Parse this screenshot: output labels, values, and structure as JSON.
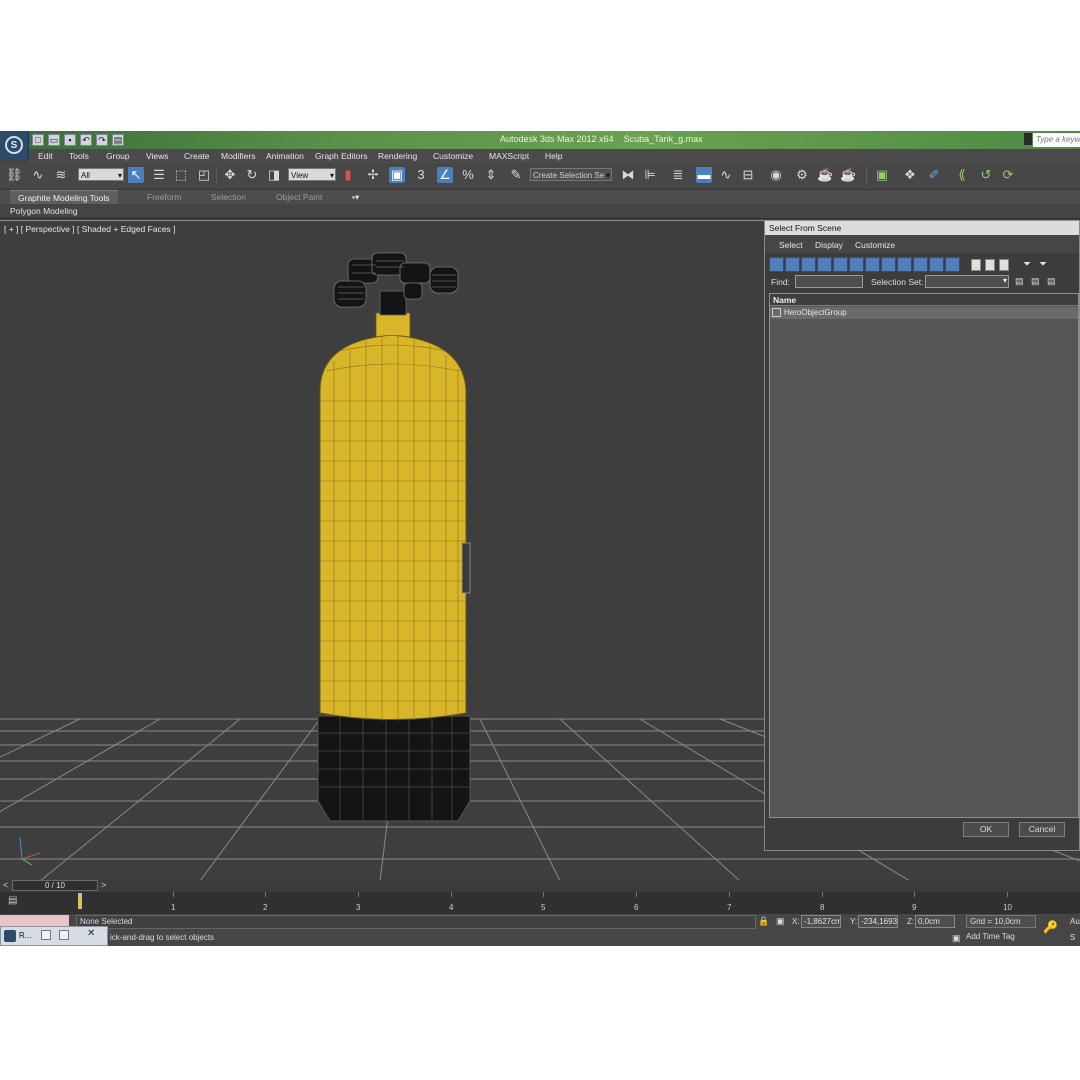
{
  "window": {
    "app_title": "Autodesk 3ds Max  2012 x64",
    "file_name": "Scuba_Tank_g.max",
    "help_search_placeholder": "Type a keyword"
  },
  "menu": [
    "Edit",
    "Tools",
    "Group",
    "Views",
    "Create",
    "Modifiers",
    "Animation",
    "Graph Editors",
    "Rendering",
    "Customize",
    "MAXScript",
    "Help"
  ],
  "toolbar": {
    "selection_filter": "All",
    "reference_coord": "View",
    "snap_label": "3",
    "named_selection_placeholder": "Create Selection Se"
  },
  "ribbon": {
    "tabs": [
      "Graphite Modeling Tools",
      "Freeform",
      "Selection",
      "Object Paint"
    ],
    "panel": "Polygon Modeling"
  },
  "viewport": {
    "label": "[ + ] [ Perspective ] [ Shaded + Edged Faces ]",
    "object_color": "#d9b52a",
    "base_color": "#141414"
  },
  "dialog": {
    "title": "Select From Scene",
    "menu": [
      "Select",
      "Display",
      "Customize"
    ],
    "find_label": "Find:",
    "selection_set_label": "Selection Set:",
    "column_name": "Name",
    "items": [
      "HeroObjectGroup"
    ],
    "ok_label": "OK",
    "cancel_label": "Cancel"
  },
  "timeline": {
    "frame_indicator": "0 / 10",
    "ticks": [
      "1",
      "2",
      "3",
      "4",
      "5",
      "6",
      "7",
      "8",
      "9",
      "10"
    ]
  },
  "status": {
    "selection": "None Selected",
    "x_label": "X:",
    "x_value": "-1,8627cm",
    "y_label": "Y:",
    "y_value": "-234,1693",
    "z_label": "Z:",
    "z_value": "0,0cm",
    "grid": "Grid = 10,0cm",
    "add_time_tag": "Add Time Tag",
    "prompt": "ick-and-drag to select objects",
    "auto_label": "Au",
    "set_label": "S",
    "taskbar_label": "R..."
  }
}
